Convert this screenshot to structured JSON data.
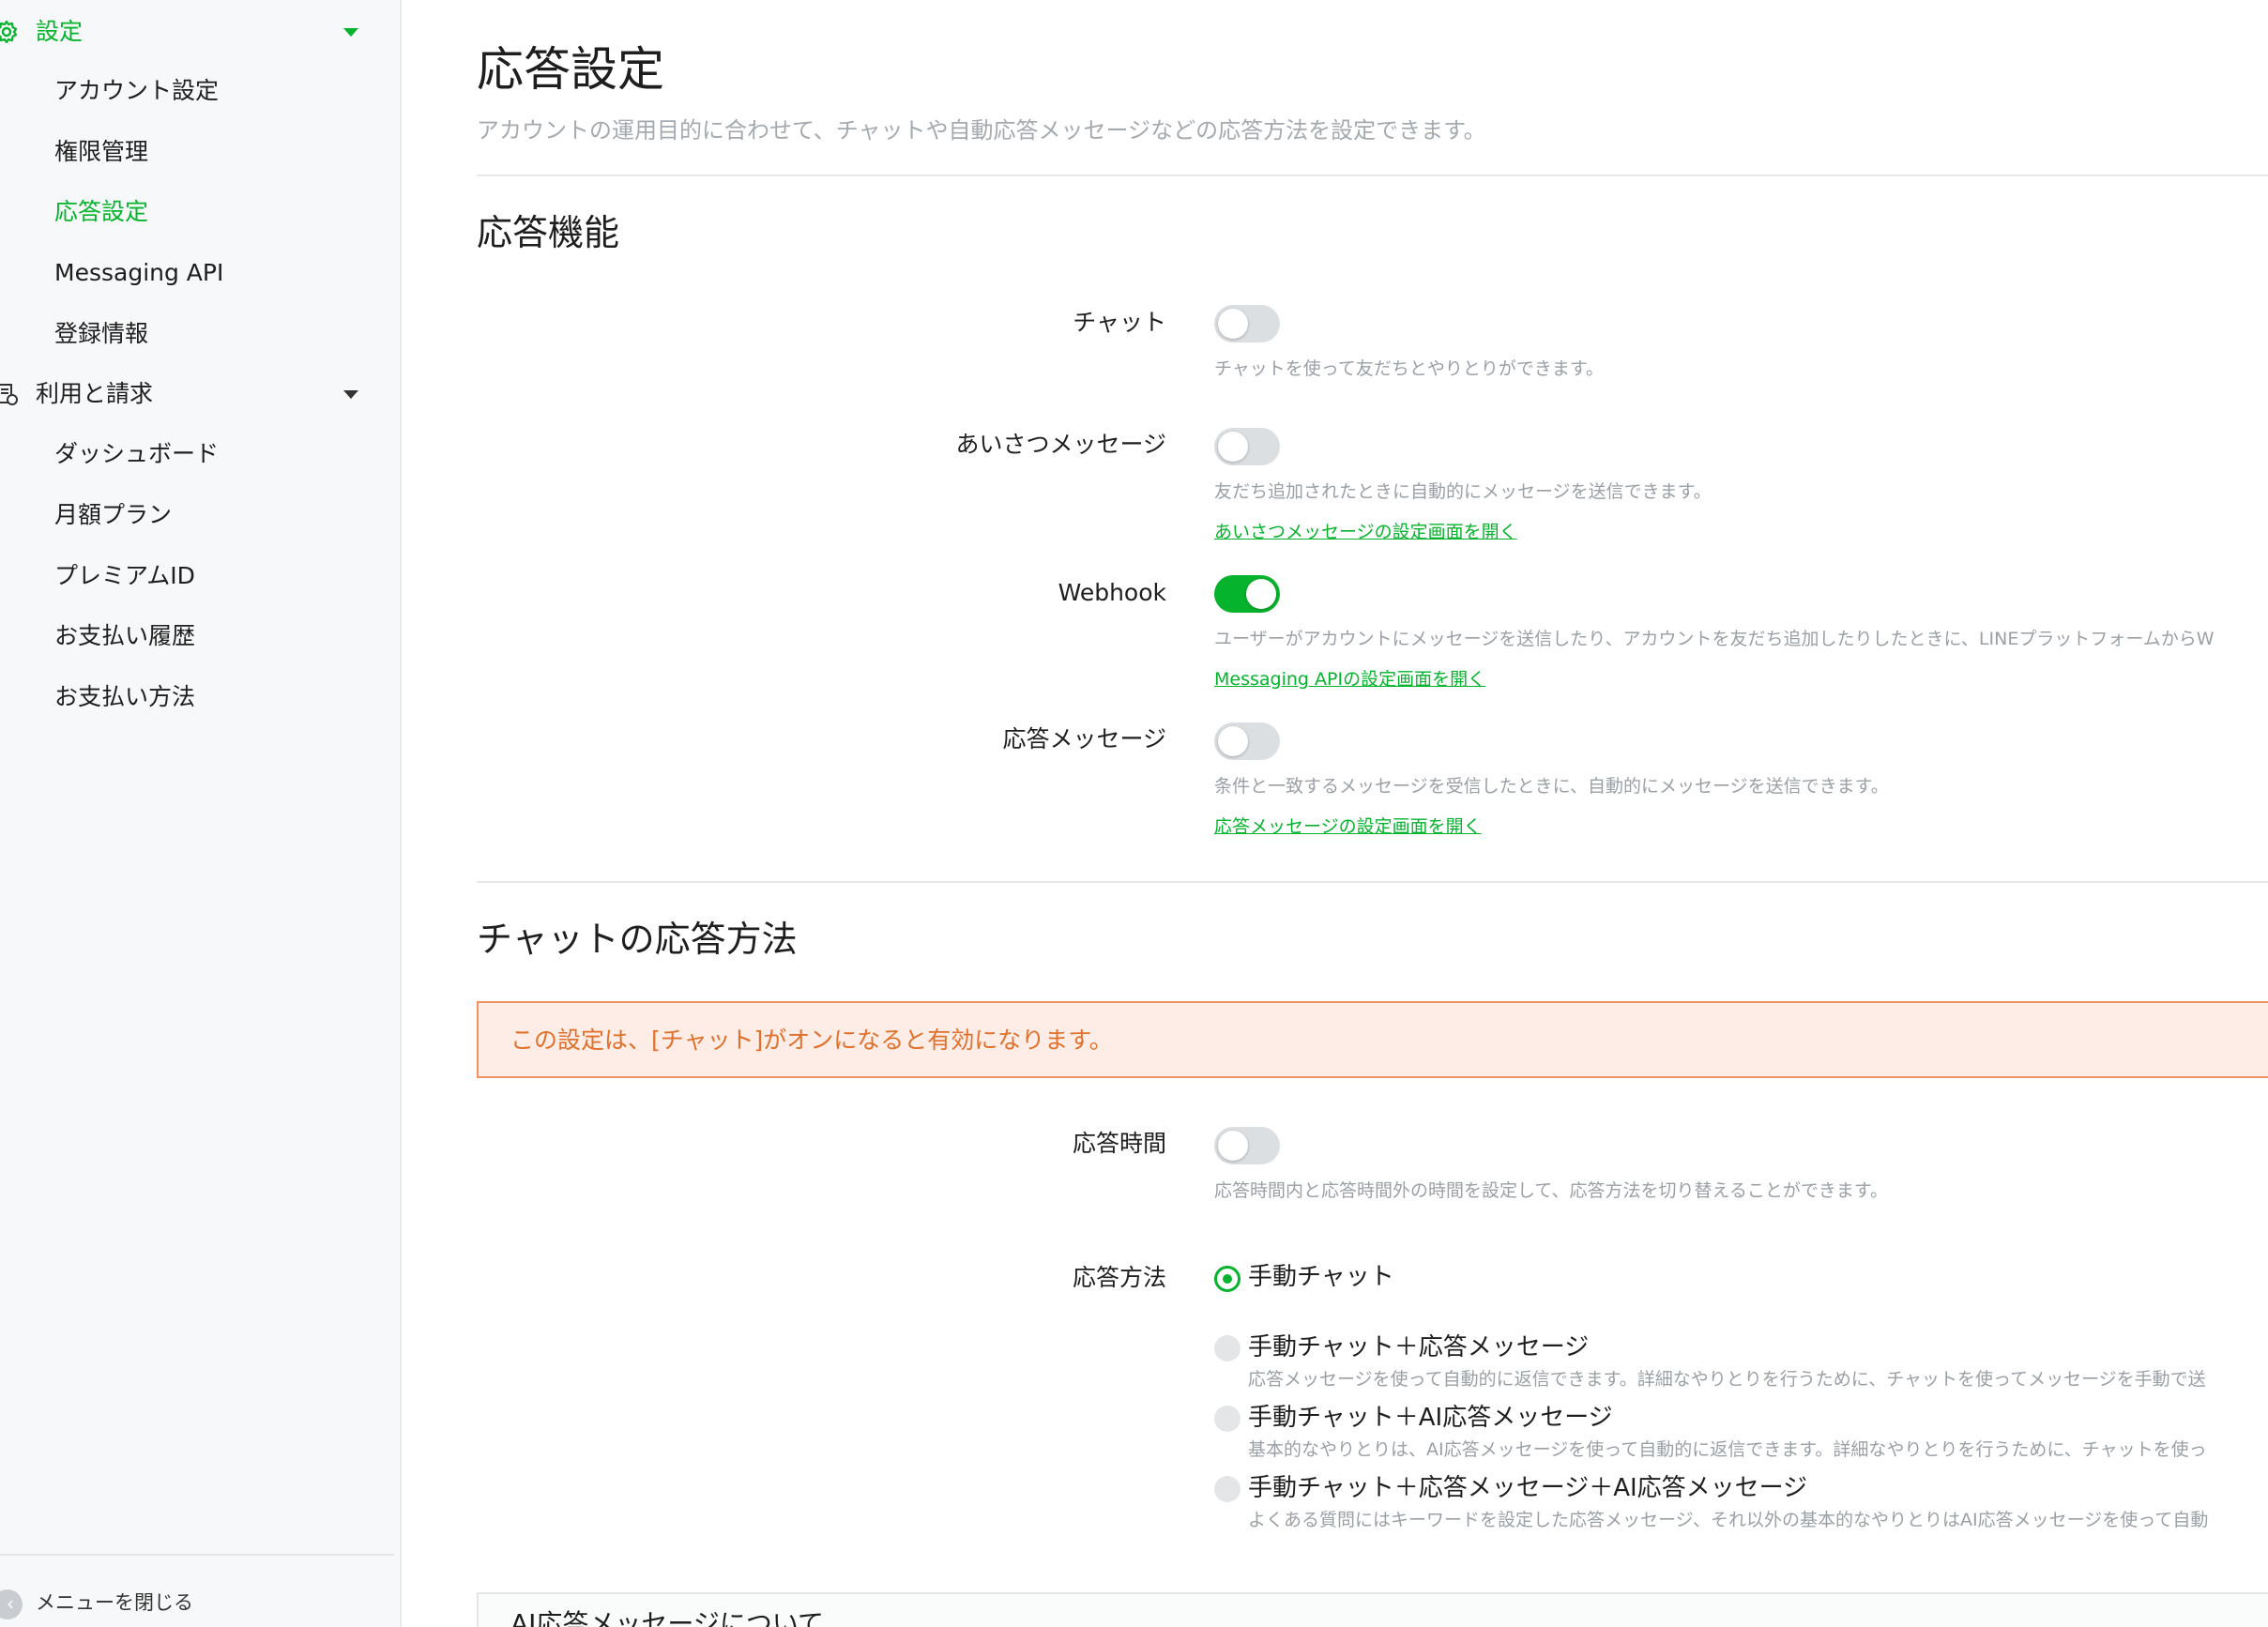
{
  "colors": {
    "accent": "#06b32d",
    "notice_bg": "#fdede6",
    "notice_border": "#f29165",
    "notice_text": "#e0702b",
    "muted": "#9aa0a6"
  },
  "sidebar": {
    "settings_label": "設定",
    "settings_items": [
      "アカウント設定",
      "権限管理",
      "応答設定",
      "Messaging API",
      "登録情報"
    ],
    "billing_label": "利用と請求",
    "billing_items": [
      "ダッシュボード",
      "月額プラン",
      "プレミアムID",
      "お支払い履歴",
      "お支払い方法"
    ],
    "collapse_label": "メニューを閉じる",
    "collapse_icon": "chevron-left-icon"
  },
  "page": {
    "title": "応答設定",
    "description": "アカウントの運用目的に合わせて、チャットや自動応答メッセージなどの応答方法を設定できます。"
  },
  "response_features": {
    "title": "応答機能",
    "chat": {
      "label": "チャット",
      "enabled": false,
      "description": "チャットを使って友だちとやりとりができます。"
    },
    "greeting": {
      "label": "あいさつメッセージ",
      "enabled": false,
      "description": "友だち追加されたときに自動的にメッセージを送信できます。",
      "link": "あいさつメッセージの設定画面を開く"
    },
    "webhook": {
      "label": "Webhook",
      "enabled": true,
      "description": "ユーザーがアカウントにメッセージを送信したり、アカウントを友だち追加したりしたときに、LINEプラットフォームからW",
      "link": "Messaging APIの設定画面を開く"
    },
    "auto_reply": {
      "label": "応答メッセージ",
      "enabled": false,
      "description": "条件と一致するメッセージを受信したときに、自動的にメッセージを送信できます。",
      "link": "応答メッセージの設定画面を開く"
    }
  },
  "chat_response": {
    "title": "チャットの応答方法",
    "notice": "この設定は、[チャット]がオンになると有効になります。",
    "hours": {
      "label": "応答時間",
      "enabled": false,
      "description": "応答時間内と応答時間外の時間を設定して、応答方法を切り替えることができます。"
    },
    "method_label": "応答方法",
    "options": [
      {
        "label": "手動チャット",
        "checked": true,
        "description": ""
      },
      {
        "label": "手動チャット＋応答メッセージ",
        "checked": false,
        "description": "応答メッセージを使って自動的に返信できます。詳細なやりとりを行うために、チャットを使ってメッセージを手動で送"
      },
      {
        "label": "手動チャット＋AI応答メッセージ",
        "checked": false,
        "description": "基本的なやりとりは、AI応答メッセージを使って自動的に返信できます。詳細なやりとりを行うために、チャットを使っ"
      },
      {
        "label": "手動チャット＋応答メッセージ＋AI応答メッセージ",
        "checked": false,
        "description": "よくある質問にはキーワードを設定した応答メッセージ、それ以外の基本的なやりとりはAI応答メッセージを使って自動"
      }
    ]
  },
  "ai_box": {
    "title": "AI応答メッセージについて"
  }
}
